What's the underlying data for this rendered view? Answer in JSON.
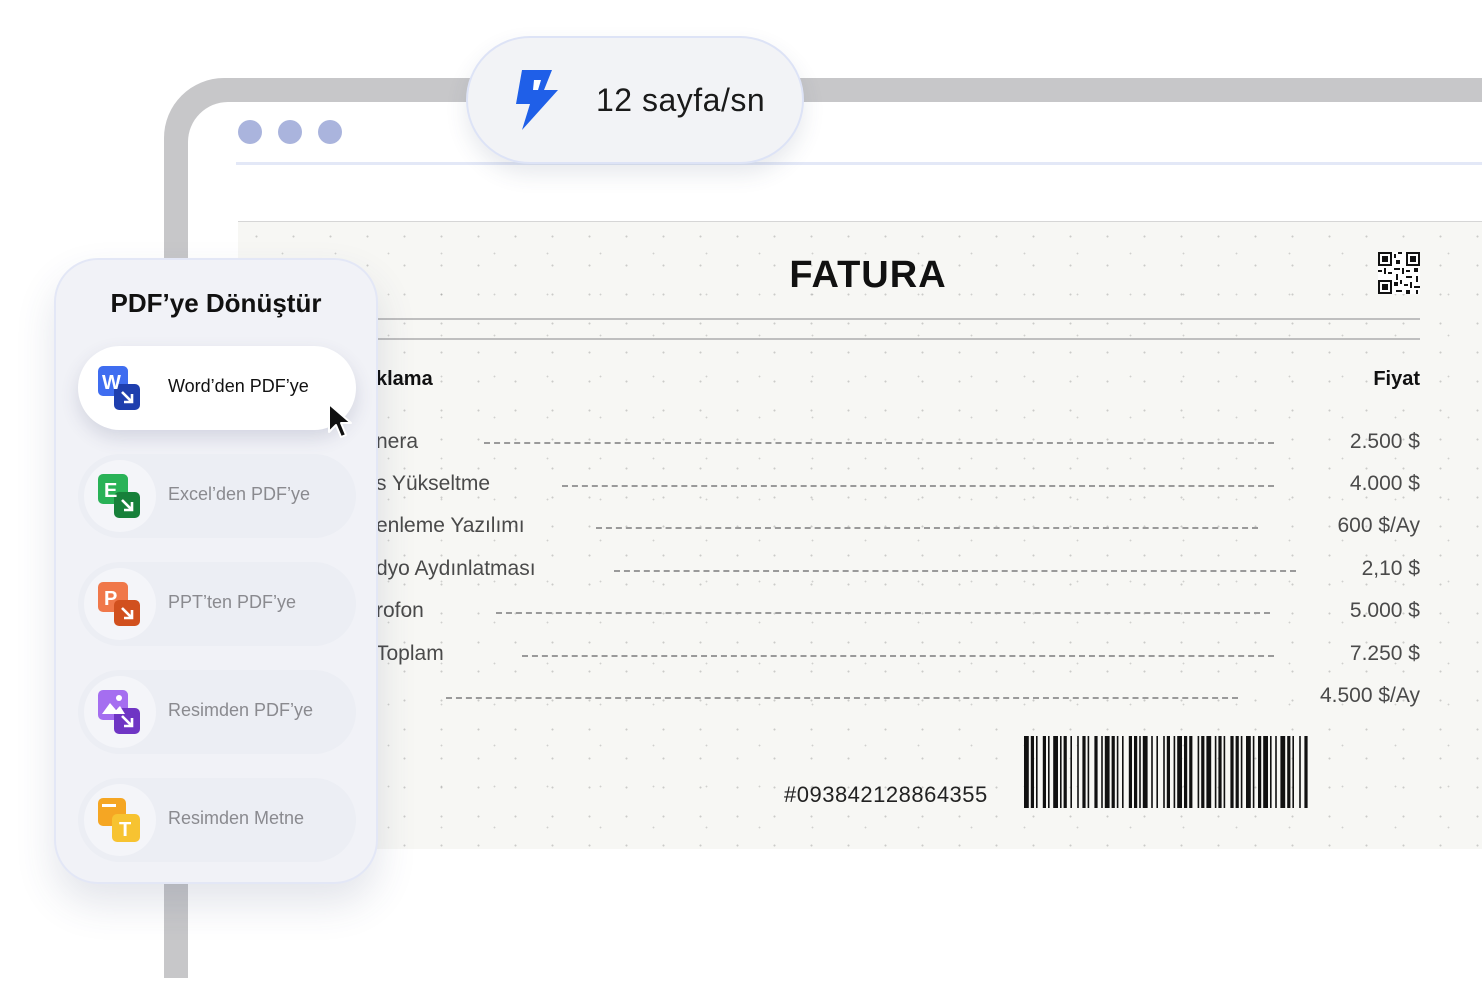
{
  "speed_badge": {
    "text": "12 sayfa/sn",
    "icon": "lightning-bolt-icon",
    "icon_color": "#1f5fe8"
  },
  "converter_panel": {
    "title": "PDF’ye Dönüştür",
    "items": [
      {
        "label": "Word’den PDF’ye",
        "icon": "word-to-pdf-icon",
        "letter": "W",
        "active": true
      },
      {
        "label": "Excel’den PDF’ye",
        "icon": "excel-to-pdf-icon",
        "letter": "E",
        "active": false
      },
      {
        "label": "PPT’ten PDF’ye",
        "icon": "ppt-to-pdf-icon",
        "letter": "P",
        "active": false
      },
      {
        "label": "Resimden PDF’ye",
        "icon": "image-to-pdf-icon",
        "letter": "",
        "active": false
      },
      {
        "label": "Resimden Metne",
        "icon": "image-to-text-icon",
        "letter": "T",
        "active": false
      }
    ]
  },
  "invoice": {
    "title": "FATURA",
    "header_description": "klama",
    "header_price": "Fiyat",
    "rows": [
      {
        "description": "nera",
        "price": "2.500 $"
      },
      {
        "description": "s Yükseltme",
        "price": "4.000 $"
      },
      {
        "description": "enleme Yazılımı",
        "price": "600 $/Ay"
      },
      {
        "description": "dyo Aydınlatması",
        "price": "2,10 $"
      },
      {
        "description": "rofon",
        "price": "5.000 $"
      },
      {
        "description": " Toplam",
        "price": "7.250 $"
      },
      {
        "description": "",
        "price": "4.500 $/Ay"
      }
    ],
    "number": "#093842128864355"
  },
  "colors": {
    "word": "#2b59d6",
    "excel": "#1f9d46",
    "ppt": "#e0602a",
    "image": "#8a4fd6",
    "text": "#f2a91f",
    "window_dots": "#aab4dd"
  }
}
